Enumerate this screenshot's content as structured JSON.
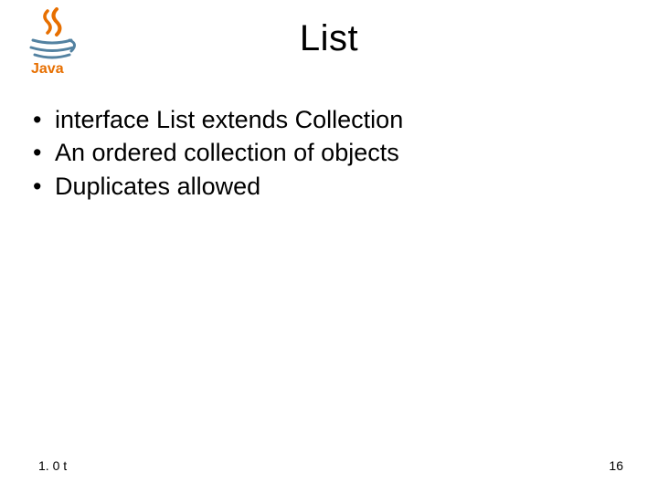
{
  "title": "List",
  "bullets": {
    "b0": "interface List extends Collection",
    "b1": "An ordered collection of objects",
    "b2": "Duplicates allowed"
  },
  "footer": {
    "left": "1. 0 t",
    "right": "16"
  },
  "logo": {
    "name": "java-logo"
  }
}
